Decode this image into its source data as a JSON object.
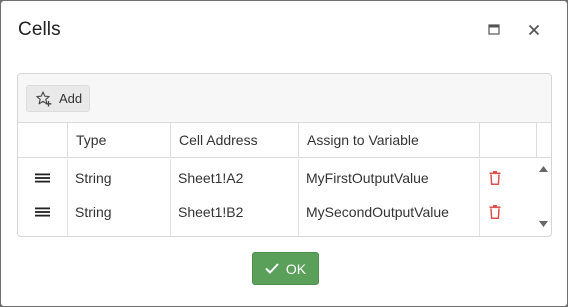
{
  "dialog": {
    "title": "Cells",
    "maximize_icon": "maximize-icon",
    "close_icon": "close-icon"
  },
  "toolbar": {
    "add_label": "Add",
    "add_icon": "star-add-icon"
  },
  "grid": {
    "columns": [
      "",
      "Type",
      "Cell Address",
      "Assign to Variable",
      ""
    ],
    "rows": [
      {
        "type": "String",
        "address": "Sheet1!A2",
        "variable": "MyFirstOutputValue"
      },
      {
        "type": "String",
        "address": "Sheet1!B2",
        "variable": "MySecondOutputValue"
      }
    ],
    "drag_icon": "drag-handle-icon",
    "delete_icon": "trash-icon"
  },
  "footer": {
    "ok_label": "OK",
    "ok_icon": "check-icon"
  },
  "colors": {
    "ok_green": "#5aa05a",
    "delete_red": "#d9534f"
  }
}
